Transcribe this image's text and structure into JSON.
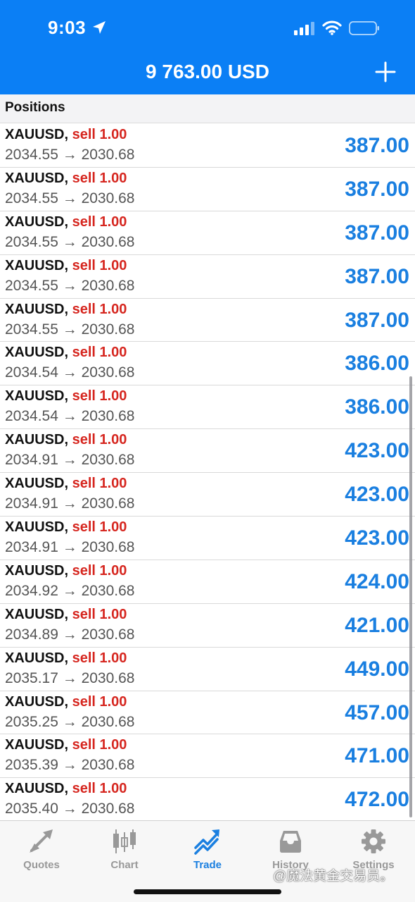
{
  "status": {
    "time": "9:03"
  },
  "header": {
    "balance": "9 763.00 USD"
  },
  "section": {
    "title": "Positions"
  },
  "positions": [
    {
      "symbol": "XAUUSD,",
      "side": "sell 1.00",
      "prices": "2034.55 → 2030.68",
      "profit": "387.00"
    },
    {
      "symbol": "XAUUSD,",
      "side": "sell 1.00",
      "prices": "2034.55 → 2030.68",
      "profit": "387.00"
    },
    {
      "symbol": "XAUUSD,",
      "side": "sell 1.00",
      "prices": "2034.55 → 2030.68",
      "profit": "387.00"
    },
    {
      "symbol": "XAUUSD,",
      "side": "sell 1.00",
      "prices": "2034.55 → 2030.68",
      "profit": "387.00"
    },
    {
      "symbol": "XAUUSD,",
      "side": "sell 1.00",
      "prices": "2034.55 → 2030.68",
      "profit": "387.00"
    },
    {
      "symbol": "XAUUSD,",
      "side": "sell 1.00",
      "prices": "2034.54 → 2030.68",
      "profit": "386.00"
    },
    {
      "symbol": "XAUUSD,",
      "side": "sell 1.00",
      "prices": "2034.54 → 2030.68",
      "profit": "386.00"
    },
    {
      "symbol": "XAUUSD,",
      "side": "sell 1.00",
      "prices": "2034.91 → 2030.68",
      "profit": "423.00"
    },
    {
      "symbol": "XAUUSD,",
      "side": "sell 1.00",
      "prices": "2034.91 → 2030.68",
      "profit": "423.00"
    },
    {
      "symbol": "XAUUSD,",
      "side": "sell 1.00",
      "prices": "2034.91 → 2030.68",
      "profit": "423.00"
    },
    {
      "symbol": "XAUUSD,",
      "side": "sell 1.00",
      "prices": "2034.92 → 2030.68",
      "profit": "424.00"
    },
    {
      "symbol": "XAUUSD,",
      "side": "sell 1.00",
      "prices": "2034.89 → 2030.68",
      "profit": "421.00"
    },
    {
      "symbol": "XAUUSD,",
      "side": "sell 1.00",
      "prices": "2035.17 → 2030.68",
      "profit": "449.00"
    },
    {
      "symbol": "XAUUSD,",
      "side": "sell 1.00",
      "prices": "2035.25 → 2030.68",
      "profit": "457.00"
    },
    {
      "symbol": "XAUUSD,",
      "side": "sell 1.00",
      "prices": "2035.39 → 2030.68",
      "profit": "471.00"
    },
    {
      "symbol": "XAUUSD,",
      "side": "sell 1.00",
      "prices": "2035.40 → 2030.68",
      "profit": "472.00"
    }
  ],
  "tabs": [
    {
      "label": "Quotes",
      "icon": "quotes-arrows-icon"
    },
    {
      "label": "Chart",
      "icon": "candlestick-icon"
    },
    {
      "label": "Trade",
      "icon": "trade-trend-icon",
      "active": true
    },
    {
      "label": "History",
      "icon": "inbox-tray-icon"
    },
    {
      "label": "Settings",
      "icon": "gear-icon"
    }
  ],
  "watermark": "@魔法黄金交易员。",
  "colors": {
    "header": "#0b7ff5",
    "sell": "#d6261f",
    "profit": "#1a7fe0",
    "tab_active": "#1a7fe0",
    "tab_inactive": "#999999"
  }
}
